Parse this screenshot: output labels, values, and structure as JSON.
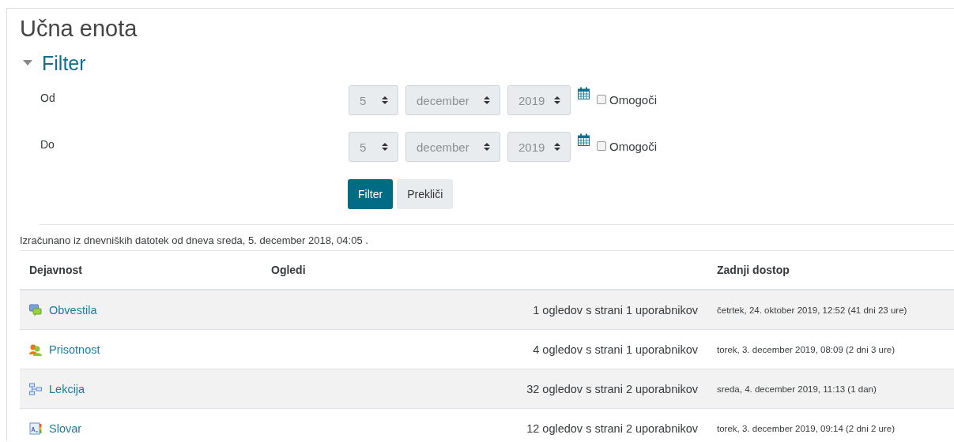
{
  "title": "Učna enota",
  "filter": {
    "heading": "Filter",
    "expanded": true,
    "dates": [
      {
        "label": "Od",
        "day": "5",
        "month": "december",
        "year": "2019",
        "enable_label": "Omogoči",
        "checked": false
      },
      {
        "label": "Do",
        "day": "5",
        "month": "december",
        "year": "2019",
        "enable_label": "Omogoči",
        "checked": false
      }
    ],
    "buttons": [
      {
        "label": "Filter",
        "kind": "primary"
      },
      {
        "label": "Prekliči",
        "kind": "secondary"
      }
    ]
  },
  "note": "Izračunano iz dnevniških datotek od dneva sreda, 5. december 2018, 04:05 .",
  "table": {
    "columns": [
      "Dejavnost",
      "Ogledi",
      "Zadnji dostop"
    ],
    "rows": [
      {
        "kind": "forum",
        "activity": "Obvestila",
        "views": "1 ogledov s strani 1 uporabnikov",
        "last_access": "četrtek, 24. oktober 2019, 12:52 (41 dni 23 ure)"
      },
      {
        "kind": "attendance",
        "activity": "Prisotnost",
        "views": "4 ogledov s strani 1 uporabnikov",
        "last_access": "torek, 3. december 2019, 08:09 (2 dni 3 ure)"
      },
      {
        "kind": "lesson",
        "activity": "Lekcija",
        "views": "32 ogledov s strani 2 uporabnikov",
        "last_access": "sreda, 4. december 2019, 11:13 (1 dan)"
      },
      {
        "kind": "glossary",
        "activity": "Slovar",
        "views": "12 ogledov s strani 2 uporabnikov",
        "last_access": "torek, 3. december 2019, 09:14 (2 dni 2 ure)"
      }
    ]
  }
}
